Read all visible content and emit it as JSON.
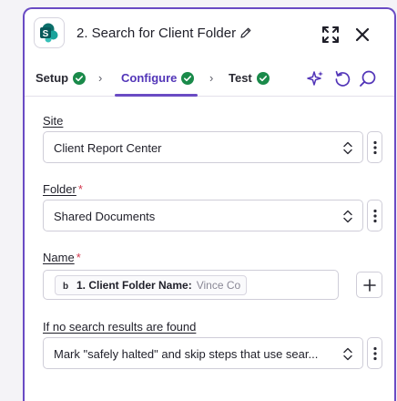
{
  "header": {
    "step_title": "2. Search for Client Folder",
    "app_icon": "sharepoint-logo",
    "edit_icon": "pencil-icon",
    "expand_icon": "expand-icon",
    "close_icon": "close-icon"
  },
  "tabs": [
    {
      "label": "Setup",
      "status": "complete",
      "active": false
    },
    {
      "label": "Configure",
      "status": "complete",
      "active": true
    },
    {
      "label": "Test",
      "status": "complete",
      "active": false
    }
  ],
  "toolbar_icons": [
    "sparkle-icon",
    "refresh-icon",
    "search-icon"
  ],
  "fields": {
    "site": {
      "label": "Site",
      "required": false,
      "value": "Client Report Center"
    },
    "folder": {
      "label": "Folder",
      "required": true,
      "required_mark": "*",
      "value": "Shared Documents"
    },
    "name": {
      "label": "Name",
      "required": true,
      "required_mark": "*",
      "token": {
        "step_label": "1. Client Folder Name:",
        "preview": "Vince Co"
      }
    },
    "no_results": {
      "label": "If no search results are found",
      "value": "Mark \"safely halted\" and skip steps that use sear..."
    }
  },
  "colors": {
    "accent": "#6a4bc4",
    "success": "#1a8a4a",
    "required": "#d3384e",
    "sharepoint": "#0b7a75"
  }
}
